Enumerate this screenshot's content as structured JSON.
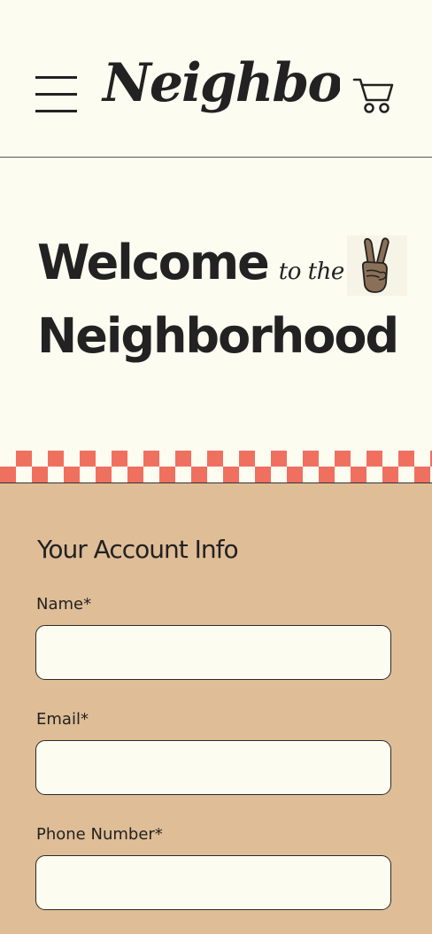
{
  "header": {
    "logo_text": "Neighborly",
    "menu_icon": "hamburger-menu-icon",
    "cart_icon": "shopping-cart-icon"
  },
  "hero": {
    "welcome": "Welcome",
    "to_the": "to the",
    "neighborhood": "Neighborhood",
    "emoji_icon": "peace-sign-hand-icon"
  },
  "form": {
    "title": "Your Account Info",
    "fields": [
      {
        "label": "Name*",
        "value": "",
        "placeholder": ""
      },
      {
        "label": "Email*",
        "value": "",
        "placeholder": ""
      },
      {
        "label": "Phone Number*",
        "value": "",
        "placeholder": ""
      }
    ]
  },
  "colors": {
    "background": "#fdfcf1",
    "form_background": "#dfbd96",
    "checker_accent": "#f07060",
    "text": "#222222"
  }
}
